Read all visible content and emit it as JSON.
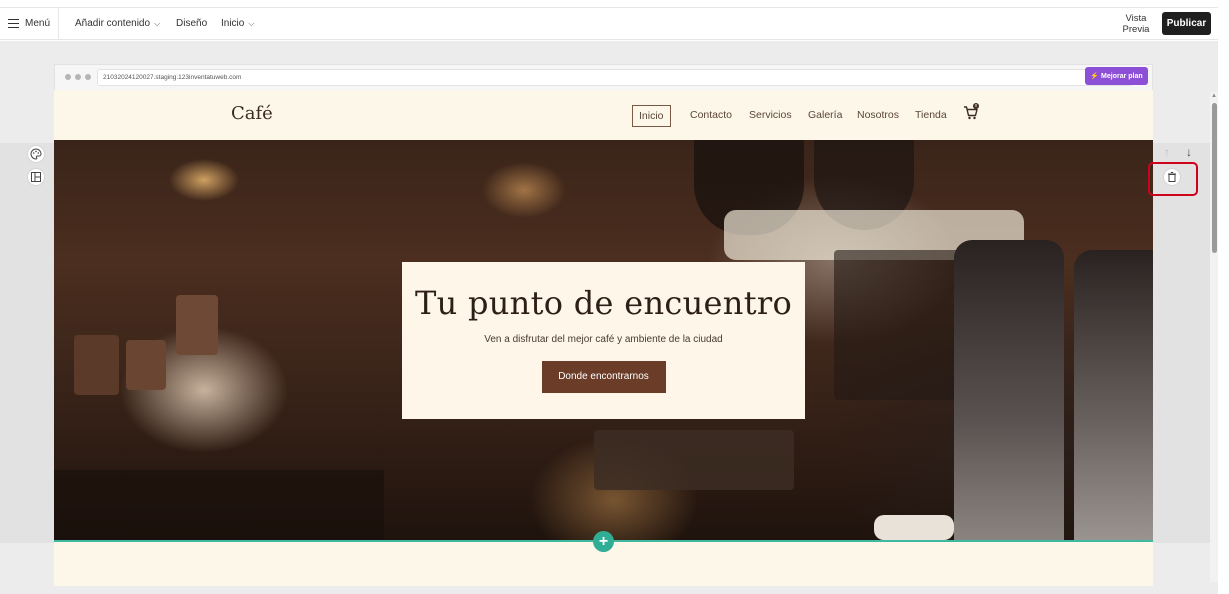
{
  "toolbar": {
    "menu_label": "Menú",
    "add_content_label": "Añadir contenido",
    "design_label": "Diseño",
    "home_label": "Inicio",
    "preview_line1": "Vista",
    "preview_line2": "Previa",
    "publish_label": "Publicar"
  },
  "browser": {
    "url": "21032024120027.staging.123inventatuweb.com",
    "upgrade_label": "Mejorar plan"
  },
  "site": {
    "logo": "Café",
    "nav": [
      "Inicio",
      "Contacto",
      "Servicios",
      "Galería",
      "Nosotros",
      "Tienda"
    ],
    "active_nav": "Inicio",
    "cart_count": "0"
  },
  "hero": {
    "title": "Tu punto de encuentro",
    "subtitle": "Ven a disfrutar del mejor café y ambiente de la ciudad",
    "button_label": "Donde encontrarnos"
  },
  "icons": {
    "menu": "hamburger-icon",
    "chevron": "chevron-down-icon",
    "upgrade": "lightning-icon",
    "cart": "cart-icon",
    "palette": "palette-icon",
    "layout": "layout-icon",
    "move_up": "arrow-up-icon",
    "move_down": "arrow-down-icon",
    "delete": "trash-icon",
    "add": "plus-icon"
  },
  "colors": {
    "publish_bg": "#1f1f1f",
    "upgrade_bg": "#8c4fd6",
    "site_bg": "#fdf7ea",
    "hero_button": "#6b3c27",
    "add_section": "#2fae95",
    "highlight": "#d0021b"
  }
}
